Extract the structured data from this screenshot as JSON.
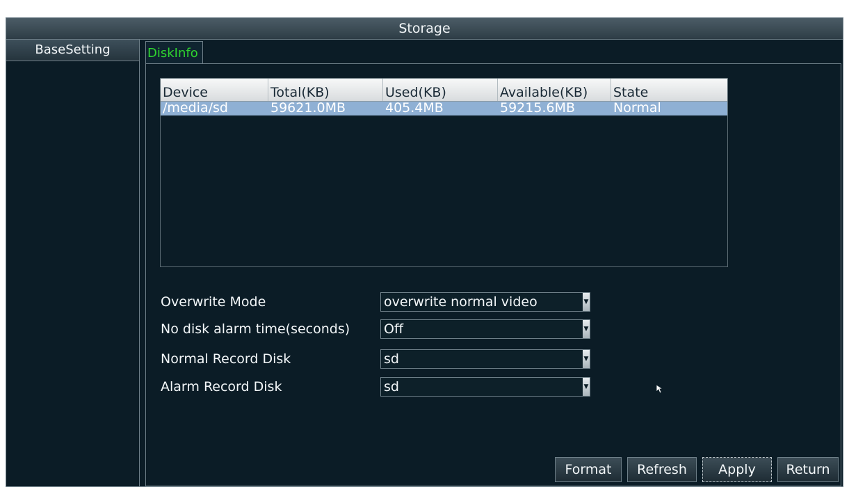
{
  "window": {
    "title": "Storage"
  },
  "sidebar": {
    "items": [
      {
        "label": "BaseSetting"
      }
    ]
  },
  "tabs": [
    {
      "label": "DiskInfo",
      "active": true
    }
  ],
  "disk_table": {
    "headers": [
      "Device",
      "Total(KB)",
      "Used(KB)",
      "Available(KB)",
      "State"
    ],
    "rows": [
      {
        "device": "/media/sd",
        "total": "59621.0MB",
        "used": "405.4MB",
        "available": "59215.6MB",
        "state": "Normal",
        "selected": true
      }
    ]
  },
  "form": {
    "overwrite_mode": {
      "label": "Overwrite Mode",
      "value": "overwrite normal video"
    },
    "no_disk_alarm": {
      "label": "No disk alarm time(seconds)",
      "value": "Off"
    },
    "normal_record_disk": {
      "label": "Normal Record Disk",
      "value": "sd"
    },
    "alarm_record_disk": {
      "label": "Alarm Record Disk",
      "value": "sd"
    }
  },
  "buttons": {
    "format": "Format",
    "refresh": "Refresh",
    "apply": "Apply",
    "return": "Return"
  },
  "icons": {
    "dropdown": "chevron-down-icon",
    "cursor": "mouse-pointer-icon"
  },
  "colors": {
    "background": "#0b1c26",
    "tab_text": "#2fd52f",
    "selected_row": "#8fb0d4",
    "border": "#6e7f88"
  }
}
